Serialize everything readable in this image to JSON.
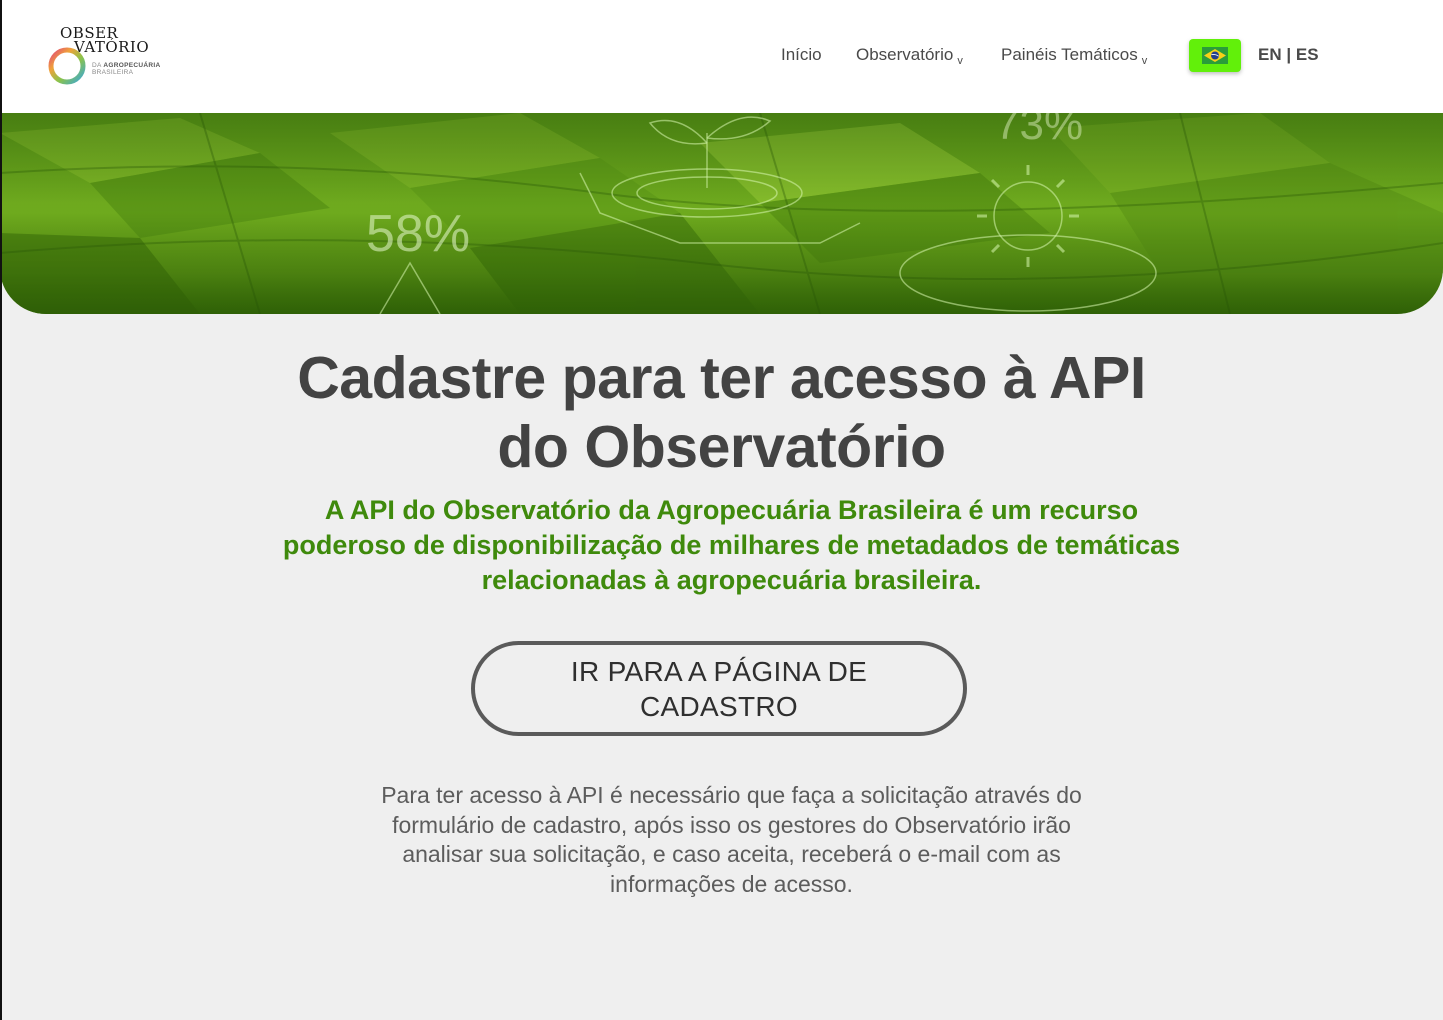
{
  "header": {
    "logo": {
      "title_line1": "OBSER",
      "title_line2": "VATÓRIO",
      "sub_line1_prefix": "DA ",
      "sub_line1_bold": "AGROPECUÁRIA",
      "sub_line2": "BRASILEIRA"
    },
    "nav": [
      {
        "label": "Início",
        "has_dropdown": false
      },
      {
        "label": "Observatório",
        "has_dropdown": true
      },
      {
        "label": "Painéis Temáticos",
        "has_dropdown": true
      }
    ],
    "dropdown_caret": "v",
    "flag_icon": "brazil-flag-icon",
    "flag_bg": "#62f00a",
    "lang": {
      "en": "EN",
      "sep": "|",
      "es": "ES"
    }
  },
  "hero": {
    "stat_left": "58%",
    "stat_right": "73%",
    "colors": {
      "green": "#71ad1f",
      "dark_green": "#3d7408"
    }
  },
  "main": {
    "title": "Cadastre para ter acesso à API do Observatório",
    "subtitle": "A API do Observatório da Agropecuária Brasileira é um recurso poderoso de disponibilização de milhares de metadados de temáticas relacionadas à agropecuária brasileira.",
    "cta_label": "IR PARA A PÁGINA DE CADASTRO",
    "info": "Para ter acesso à API é necessário que faça a solicitação através do formulário de cadastro, após isso os gestores do Observatório irão analisar sua solicitação, e caso aceita, receberá o e-mail com as informações de acesso."
  },
  "colors": {
    "accent_green": "#3f8a0c",
    "title_gray": "#434343",
    "page_bg": "#efefef"
  }
}
